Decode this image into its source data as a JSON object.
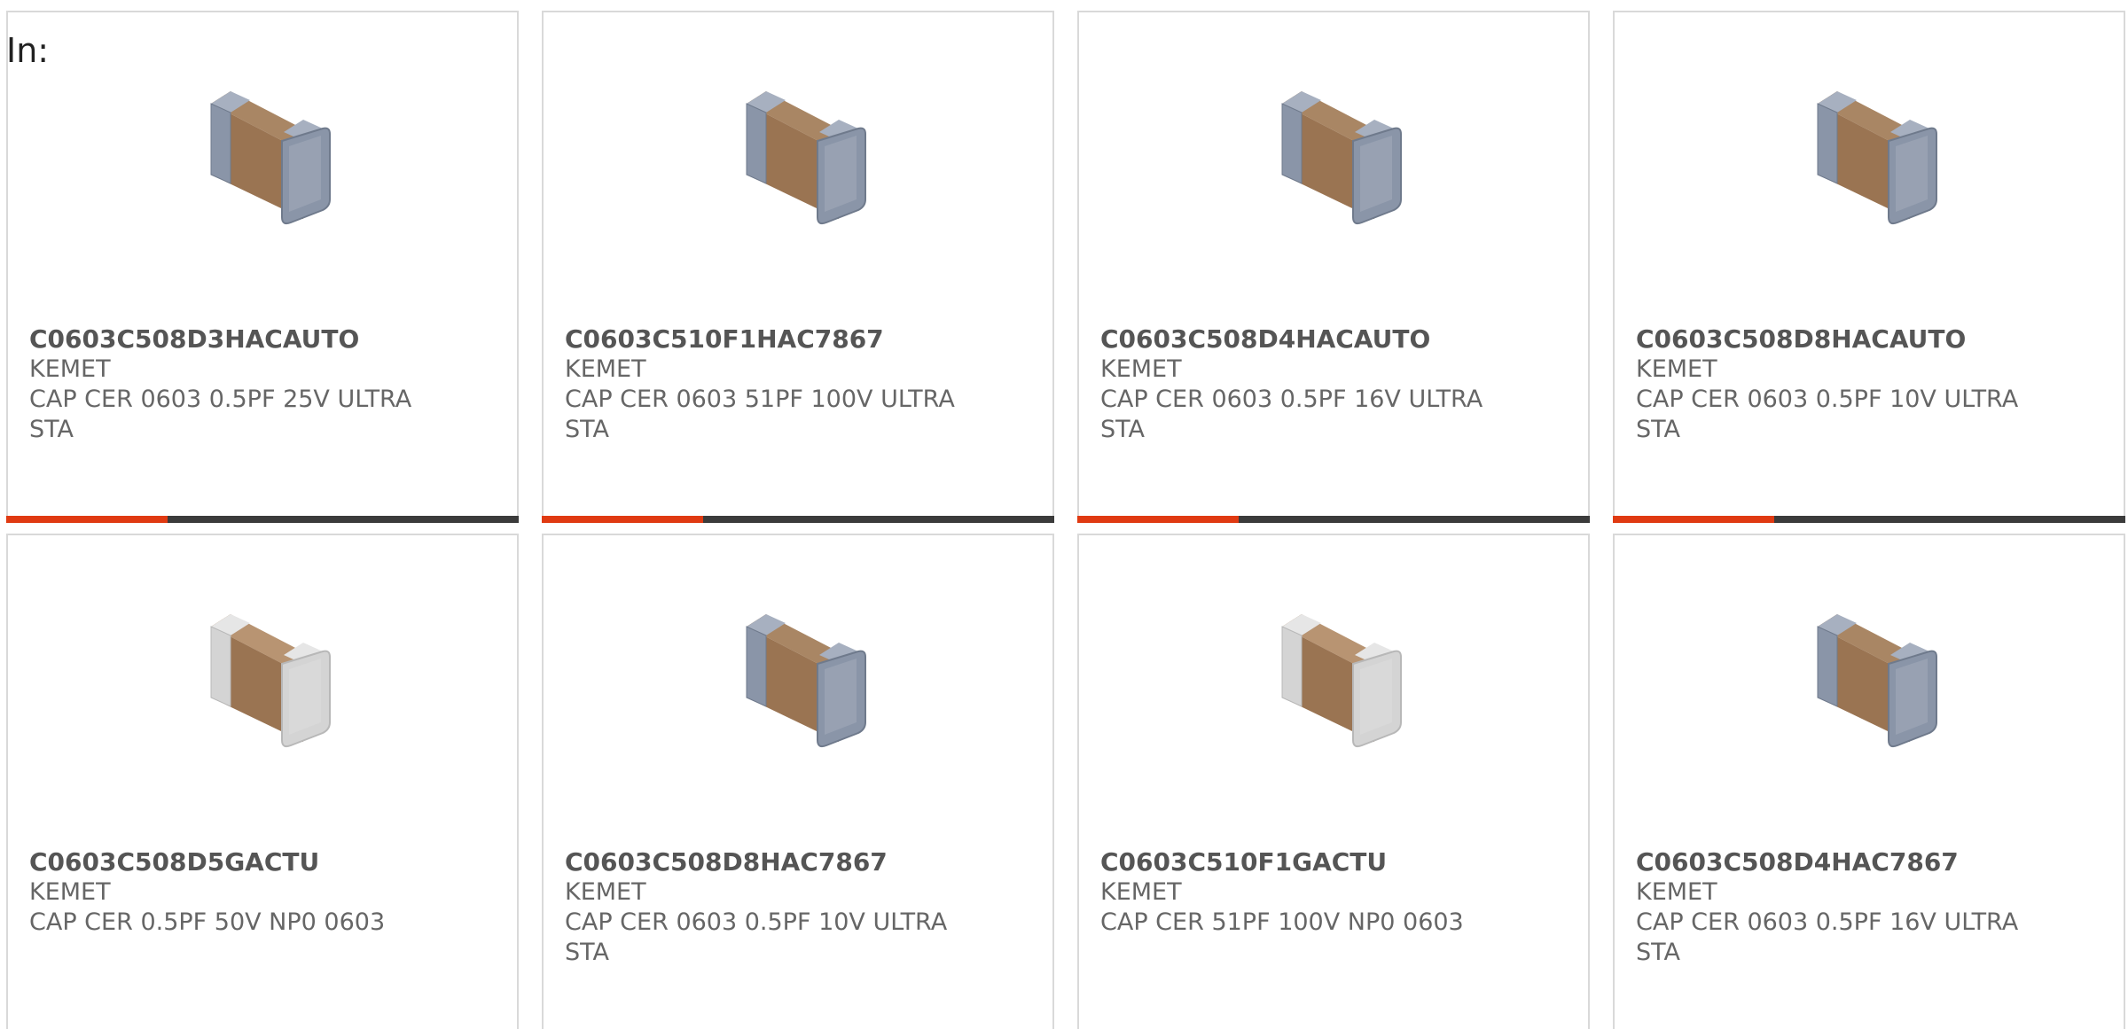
{
  "section_label": "In:",
  "products": [
    {
      "part": "C0603C508D3HACAUTO",
      "manufacturer": "KEMET",
      "description": "CAP CER 0603 0.5PF 25V ULTRA STA",
      "image_style": "dark",
      "has_bar": true
    },
    {
      "part": "C0603C510F1HAC7867",
      "manufacturer": "KEMET",
      "description": "CAP CER 0603 51PF 100V ULTRA STA",
      "image_style": "dark",
      "has_bar": true
    },
    {
      "part": "C0603C508D4HACAUTO",
      "manufacturer": "KEMET",
      "description": "CAP CER 0603 0.5PF 16V ULTRA STA",
      "image_style": "dark",
      "has_bar": true
    },
    {
      "part": "C0603C508D8HACAUTO",
      "manufacturer": "KEMET",
      "description": "CAP CER 0603 0.5PF 10V ULTRA STA",
      "image_style": "dark",
      "has_bar": true
    },
    {
      "part": "C0603C508D5GACTU",
      "manufacturer": "KEMET",
      "description": "CAP CER 0.5PF 50V NP0 0603",
      "image_style": "light",
      "has_bar": false
    },
    {
      "part": "C0603C508D8HAC7867",
      "manufacturer": "KEMET",
      "description": "CAP CER 0603 0.5PF 10V ULTRA STA",
      "image_style": "dark",
      "has_bar": false
    },
    {
      "part": "C0603C510F1GACTU",
      "manufacturer": "KEMET",
      "description": "CAP CER 51PF 100V NP0 0603",
      "image_style": "light",
      "has_bar": false
    },
    {
      "part": "C0603C508D4HAC7867",
      "manufacturer": "KEMET",
      "description": "CAP CER 0603 0.5PF 16V ULTRA STA",
      "image_style": "dark",
      "has_bar": false
    }
  ],
  "colors": {
    "accent": "#e03a12",
    "bar": "#3b3b3b",
    "text": "#666666",
    "border": "#d9d9d9",
    "chip_body": "#9a7452",
    "chip_terminal_dark": "#8a95a8",
    "chip_terminal_light": "#d4d4d4"
  }
}
